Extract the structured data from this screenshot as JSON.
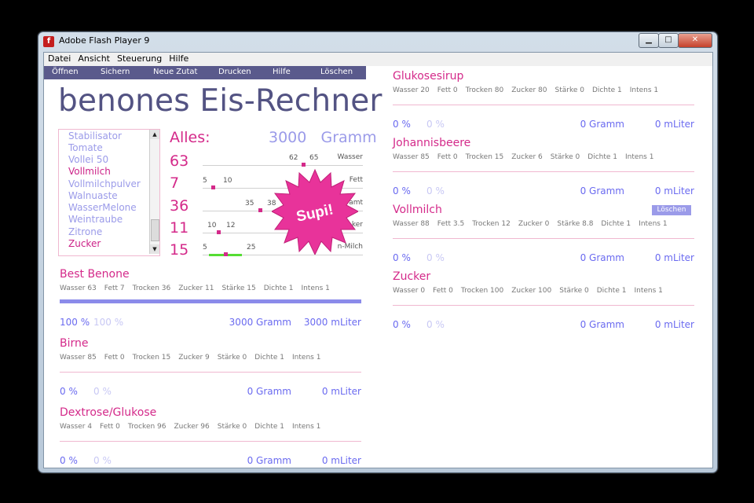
{
  "window": {
    "title": "Adobe Flash Player 9",
    "app_icon": "f",
    "min_glyph": "▁",
    "max_glyph": "□",
    "close_glyph": "✕"
  },
  "menubar": [
    "Datei",
    "Ansicht",
    "Steuerung",
    "Hilfe"
  ],
  "toolbar": [
    "Öffnen",
    "Sichern",
    "Neue Zutat",
    "Drucken",
    "Hilfe",
    "Löschen"
  ],
  "app_title": "benones Eis-Rechner",
  "listbox": {
    "items": [
      {
        "label": "Stabilisator",
        "selected": false
      },
      {
        "label": "Tomate",
        "selected": false
      },
      {
        "label": "Vollei 50",
        "selected": false
      },
      {
        "label": "Vollmilch",
        "selected": true
      },
      {
        "label": "Vollmilchpulver",
        "selected": false
      },
      {
        "label": "Walnuaste",
        "selected": false
      },
      {
        "label": "WasserMelone",
        "selected": false
      },
      {
        "label": "Weintraube",
        "selected": false
      },
      {
        "label": "Zitrone",
        "selected": false
      },
      {
        "label": "Zucker",
        "selected": true
      }
    ],
    "scroll_up": "▲",
    "scroll_down": "▼"
  },
  "summary": {
    "alles_label": "Alles:",
    "total": "3000",
    "unit": "Gramm",
    "rows": [
      {
        "value": "63",
        "lo": "62",
        "hi": "65",
        "label": "Wasser"
      },
      {
        "value": "7",
        "lo": "5",
        "hi": "10",
        "label": "Fett"
      },
      {
        "value": "36",
        "lo": "35",
        "hi": "38",
        "label": "amt"
      },
      {
        "value": "11",
        "lo": "10",
        "hi": "12",
        "label": "ker"
      },
      {
        "value": "15",
        "lo": "5",
        "hi": "25",
        "label": "n-Milch"
      }
    ],
    "badge": "Supi!"
  },
  "cards_left": [
    {
      "name": "Best Benone",
      "props": [
        "Wasser 63",
        "Fett 7",
        "Trocken 36",
        "Zucker 11",
        "Stärke 15",
        "Dichte 1",
        "Intens 1"
      ],
      "pct": "100 %",
      "pct2": "100 %",
      "gramm": "3000 Gramm",
      "liter": "3000 mLiter",
      "bar": "blue"
    },
    {
      "name": "Birne",
      "props": [
        "Wasser 85",
        "Fett 0",
        "Trocken 15",
        "Zucker 9",
        "Stärke 0",
        "Dichte 1",
        "Intens 1"
      ],
      "pct": "0 %",
      "pct2": "0 %",
      "gramm": "0 Gramm",
      "liter": "0 mLiter"
    },
    {
      "name": "Dextrose/Glukose",
      "props": [
        "Wasser 4",
        "Fett 0",
        "Trocken 96",
        "Zucker 96",
        "Stärke 0",
        "Dichte 1",
        "Intens 1"
      ],
      "pct": "0 %",
      "pct2": "0 %",
      "gramm": "0 Gramm",
      "liter": "0 mLiter"
    }
  ],
  "cards_right": [
    {
      "name": "Glukosesirup",
      "props": [
        "Wasser 20",
        "Fett 0",
        "Trocken 80",
        "Zucker 80",
        "Stärke 0",
        "Dichte 1",
        "Intens 1"
      ],
      "pct": "0 %",
      "pct2": "0 %",
      "gramm": "0 Gramm",
      "liter": "0 mLiter"
    },
    {
      "name": "Johannisbeere",
      "props": [
        "Wasser 85",
        "Fett 0",
        "Trocken 15",
        "Zucker 6",
        "Stärke 0",
        "Dichte 1",
        "Intens 1"
      ],
      "pct": "0 %",
      "pct2": "0 %",
      "gramm": "0 Gramm",
      "liter": "0 mLiter"
    },
    {
      "name": "Vollmilch",
      "props": [
        "Wasser 88",
        "Fett 3.5",
        "Trocken 12",
        "Zucker 0",
        "Stärke 8.8",
        "Dichte 1",
        "Intens 1"
      ],
      "pct": "0 %",
      "pct2": "0 %",
      "gramm": "0 Gramm",
      "liter": "0 mLiter",
      "delete_label": "Löschen"
    },
    {
      "name": "Zucker",
      "props": [
        "Wasser 0",
        "Fett 0",
        "Trocken 100",
        "Zucker 100",
        "Stärke 0",
        "Dichte 1",
        "Intens 1"
      ],
      "pct": "0 %",
      "pct2": "0 %",
      "gramm": "0 Gramm",
      "liter": "0 mLiter"
    }
  ]
}
